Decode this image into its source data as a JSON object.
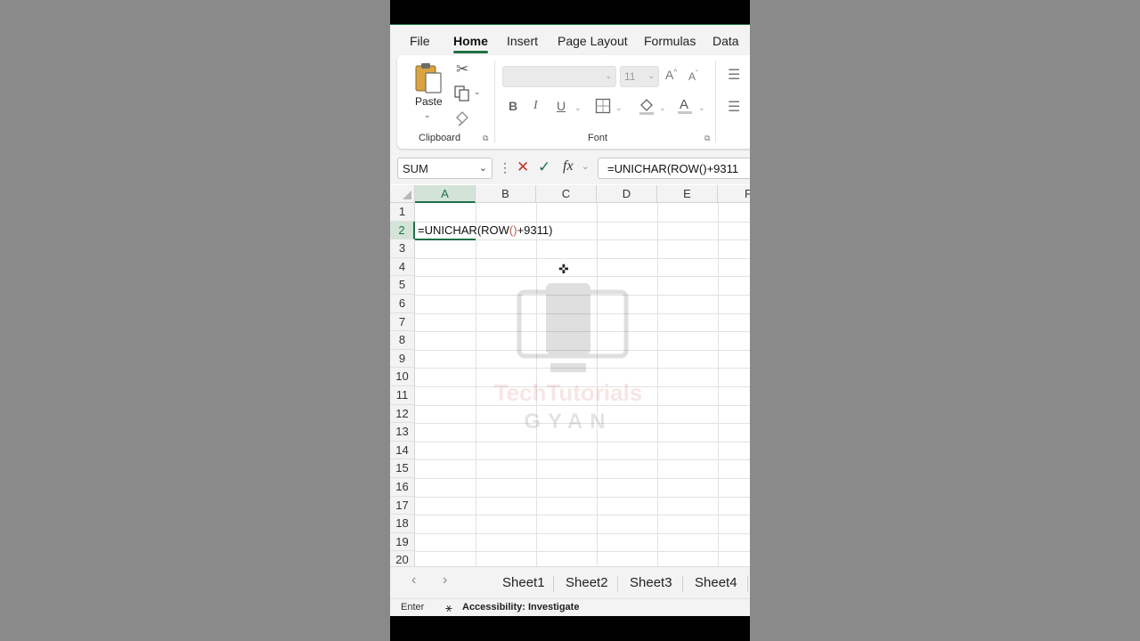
{
  "ribbon_tabs": [
    "File",
    "Home",
    "Insert",
    "Page Layout",
    "Formulas",
    "Data"
  ],
  "active_tab": "Home",
  "clipboard": {
    "paste_label": "Paste",
    "group_label": "Clipboard"
  },
  "font": {
    "font_name": "",
    "font_size": "11",
    "group_label": "Font",
    "bold": "B",
    "italic": "I",
    "underline": "U"
  },
  "formula_bar": {
    "name_box": "SUM",
    "fx_label": "fx",
    "formula": "=UNICHAR(ROW()+9311"
  },
  "grid": {
    "columns": [
      "A",
      "B",
      "C",
      "D",
      "E",
      "F"
    ],
    "rows": [
      "1",
      "2",
      "3",
      "4",
      "5",
      "6",
      "7",
      "8",
      "9",
      "10",
      "11",
      "12",
      "13",
      "14",
      "15",
      "16",
      "17",
      "18",
      "19",
      "20"
    ],
    "selected_column": "A",
    "selected_row": "2",
    "active_cell_text": {
      "part1": "=UNICHAR(ROW",
      "part2": "()",
      "part3": "+9311)"
    }
  },
  "watermark": {
    "line1": "TechTutorials",
    "line2": "GYAN"
  },
  "sheets": [
    "Sheet1",
    "Sheet2",
    "Sheet3",
    "Sheet4"
  ],
  "status_bar": {
    "mode": "Enter",
    "accessibility": "Accessibility: Investigate"
  },
  "colors": {
    "accent": "#1e7145",
    "paren": "#b5594c",
    "watermark_red": "#c0392b"
  },
  "icons": [
    "cut-icon",
    "copy-icon",
    "format-painter-icon",
    "grow-font-icon",
    "shrink-font-icon",
    "borders-icon",
    "fill-color-icon",
    "font-color-icon",
    "align-top-icon",
    "align-left-icon",
    "cancel-icon",
    "enter-icon",
    "fx-icon"
  ]
}
